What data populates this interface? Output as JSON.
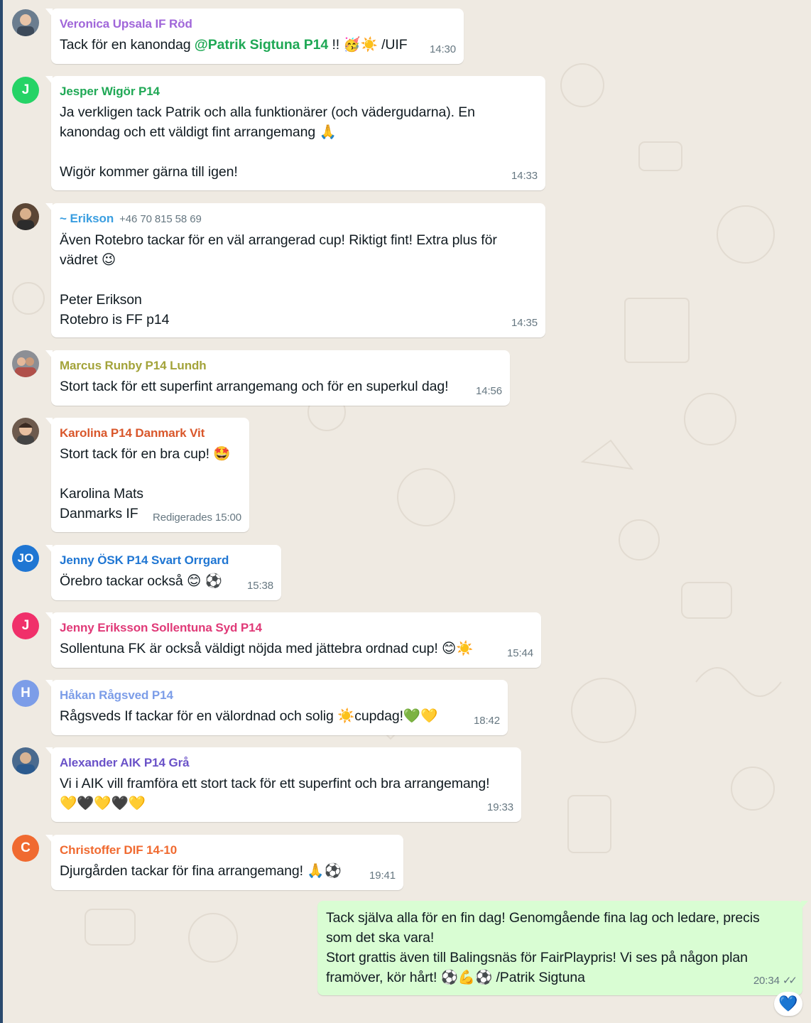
{
  "messages": [
    {
      "sender": "Veronica Upsala IF Röd",
      "sender_color": "#a066d9",
      "avatar": "photo",
      "text_parts": [
        "Tack för en kanondag ",
        "@Patrik Sigtuna P14",
        " !! 🥳☀️ /UIF"
      ],
      "time": "14:30"
    },
    {
      "sender": "Jesper Wigör P14",
      "sender_color": "#1fa855",
      "avatar": "J",
      "avatar_color": "#25d366",
      "text": "Ja verkligen tack Patrik och alla funktionärer (och vädergudarna). En\nkanondag och ett väldigt fint arrangemang 🙏\n\nWigör kommer gärna till igen!",
      "time": "14:33"
    },
    {
      "sender": "~ Erikson",
      "phone": "+46 70 815 58 69",
      "sender_color": "#3a9ee0",
      "avatar": "photo",
      "text": "Även Rotebro tackar för en väl arrangerad cup! Riktigt fint! Extra plus för\nvädret 😉\n\nPeter Erikson\nRotebro is FF p14",
      "time": "14:35"
    },
    {
      "sender": "Marcus Runby P14 Lundh",
      "sender_color": "#a3a33a",
      "avatar": "photo",
      "text": "Stort tack för ett superfint arrangemang och för en superkul dag!",
      "time": "14:56"
    },
    {
      "sender": "Karolina P14 Danmark Vit",
      "sender_color": "#d9572b",
      "avatar": "photo",
      "text": "Stort tack för en bra cup! 🤩\n\nKarolina Mats\nDanmarks IF",
      "edited": "Redigerades",
      "time": "15:00"
    },
    {
      "sender": "Jenny ÖSK P14 Svart Orrgard",
      "sender_color": "#1f76d3",
      "avatar": "JO",
      "avatar_color": "#1f76d3",
      "text": "Örebro tackar också 😊 ⚽",
      "time": "15:38"
    },
    {
      "sender": "Jenny Eriksson Sollentuna Syd P14",
      "sender_color": "#e03a78",
      "avatar": "J",
      "avatar_color": "#f0306a",
      "text": "Sollentuna FK är också väldigt nöjda med jättebra ordnad cup! 😊☀️",
      "time": "15:44"
    },
    {
      "sender": "Håkan Rågsved P14",
      "sender_color": "#7c9de8",
      "avatar": "H",
      "avatar_color": "#7c9de8",
      "text": "Rågsveds If tackar för en välordnad och solig ☀️cupdag!💚💛",
      "time": "18:42"
    },
    {
      "sender": "Alexander AIK P14 Grå",
      "sender_color": "#6a52c8",
      "avatar": "photo",
      "text": "Vi i AIK vill framföra ett stort tack för ett superfint och bra arrangemang!\n💛🖤💛🖤💛",
      "time": "19:33"
    },
    {
      "sender": "Christoffer DIF 14-10",
      "sender_color": "#f06a30",
      "avatar": "C",
      "avatar_color": "#f06a30",
      "text": "Djurgården tackar för fina arrangemang! 🙏⚽",
      "time": "19:41"
    }
  ],
  "outgoing": {
    "text": "Tack själva alla för en fin dag! Genomgående fina lag och ledare, precis\nsom det ska vara!\nStort grattis även till Balingsnäs för FairPlaypris! Vi ses på någon plan\nframöver, kör hårt! ⚽💪⚽ /Patrik Sigtuna",
    "time": "20:34",
    "status": "✓✓",
    "reaction": "💙"
  }
}
